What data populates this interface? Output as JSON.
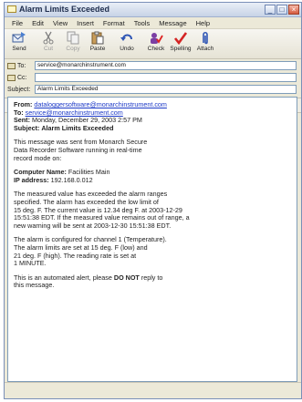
{
  "window": {
    "title": "Alarm Limits Exceeded"
  },
  "menu": [
    "File",
    "Edit",
    "View",
    "Insert",
    "Format",
    "Tools",
    "Message",
    "Help"
  ],
  "toolbar": {
    "send": "Send",
    "cut": "Cut",
    "copy": "Copy",
    "paste": "Paste",
    "undo": "Undo",
    "check": "Check",
    "spelling": "Spelling",
    "attach": "Attach"
  },
  "fields": {
    "to_label": "To:",
    "to_value": "service@monarchinstrument.com",
    "cc_label": "Cc:",
    "cc_value": "",
    "subject_label": "Subject:",
    "subject_value": "Alarm Limits Exceeded"
  },
  "format": {
    "font": "Arial",
    "size": "10"
  },
  "message": {
    "from_key": "From:",
    "from_value": "dataloggersoftware@monarchinstrument.com",
    "to_key": "To:",
    "to_value": "service@monarchinstrument.com",
    "sent_key": "Sent:",
    "sent_value": "Monday, December 29, 2003 2:57 PM",
    "subject_key": "Subject:",
    "subject_value": "Alarm Limits Exceeded",
    "p1": [
      "This message was sent from Monarch Secure",
      "Data Recorder Software running in real-time",
      "record mode on:"
    ],
    "computer_key": "Computer Name:",
    "computer_value": "Facilities Main",
    "ip_key": "IP address:",
    "ip_value": "192.168.0.012",
    "p2": [
      "The measured value has exceeded the alarm ranges",
      "specified. The alarm has exceeded the low limit of",
      "15 deg. F. The current value is 12.34 deg F. at 2003-12-29",
      "15:51:38 EDT. If the measured value remains out of range, a",
      "new warning will be sent at 2003-12-30 15:51:38 EDT."
    ],
    "p3": [
      "The alarm is configured for channel 1 (Temperature).",
      "The alarm limits are set at 15 deg. F (low) and",
      "21 deg. F (high). The reading rate is set at",
      "1 MINUTE."
    ],
    "p4_pre": "This is an automated alert, please ",
    "p4_bold": "DO NOT",
    "p4_post": " reply to",
    "p4_line2": "this message."
  }
}
